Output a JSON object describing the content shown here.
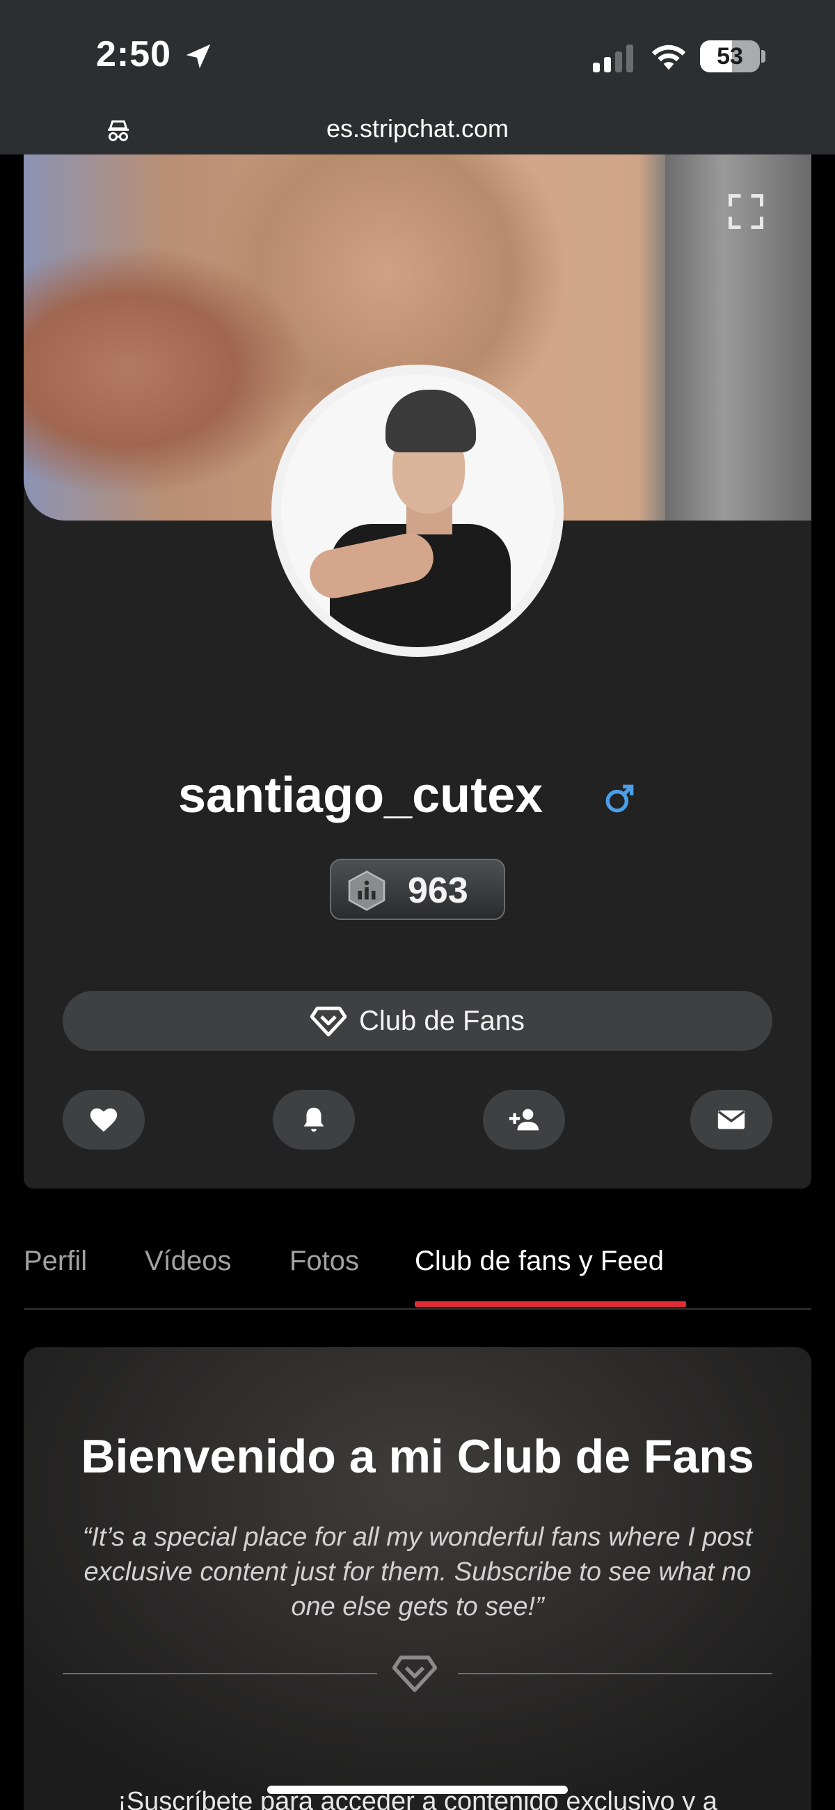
{
  "status_bar": {
    "time": "2:50",
    "battery_percent": "53",
    "battery_level": 0.53
  },
  "browser": {
    "url": "es.stripchat.com"
  },
  "profile": {
    "username": "santiago_cutex",
    "gender_icon": "male-symbol-icon",
    "level": "963",
    "fan_club_button": "Club de Fans",
    "actions": [
      "heart-icon",
      "bell-icon",
      "add-user-icon",
      "envelope-icon"
    ]
  },
  "tabs": [
    {
      "label": "Perfil",
      "active": false
    },
    {
      "label": "Vídeos",
      "active": false
    },
    {
      "label": "Fotos",
      "active": false
    },
    {
      "label": "Club de fans y Feed",
      "active": true
    }
  ],
  "fan_club": {
    "title": "Bienvenido a mi Club de Fans",
    "quote": "“It’s a special place for all my wonderful fans where I post exclusive content just for them. Subscribe to see what no one else gets to see!”",
    "subscribe_text": "¡Suscríbete para acceder a contenido exclusivo y a"
  },
  "colors": {
    "accent_red": "#e02c34",
    "gender_blue": "#4a9fe8",
    "card_bg": "#222223"
  }
}
